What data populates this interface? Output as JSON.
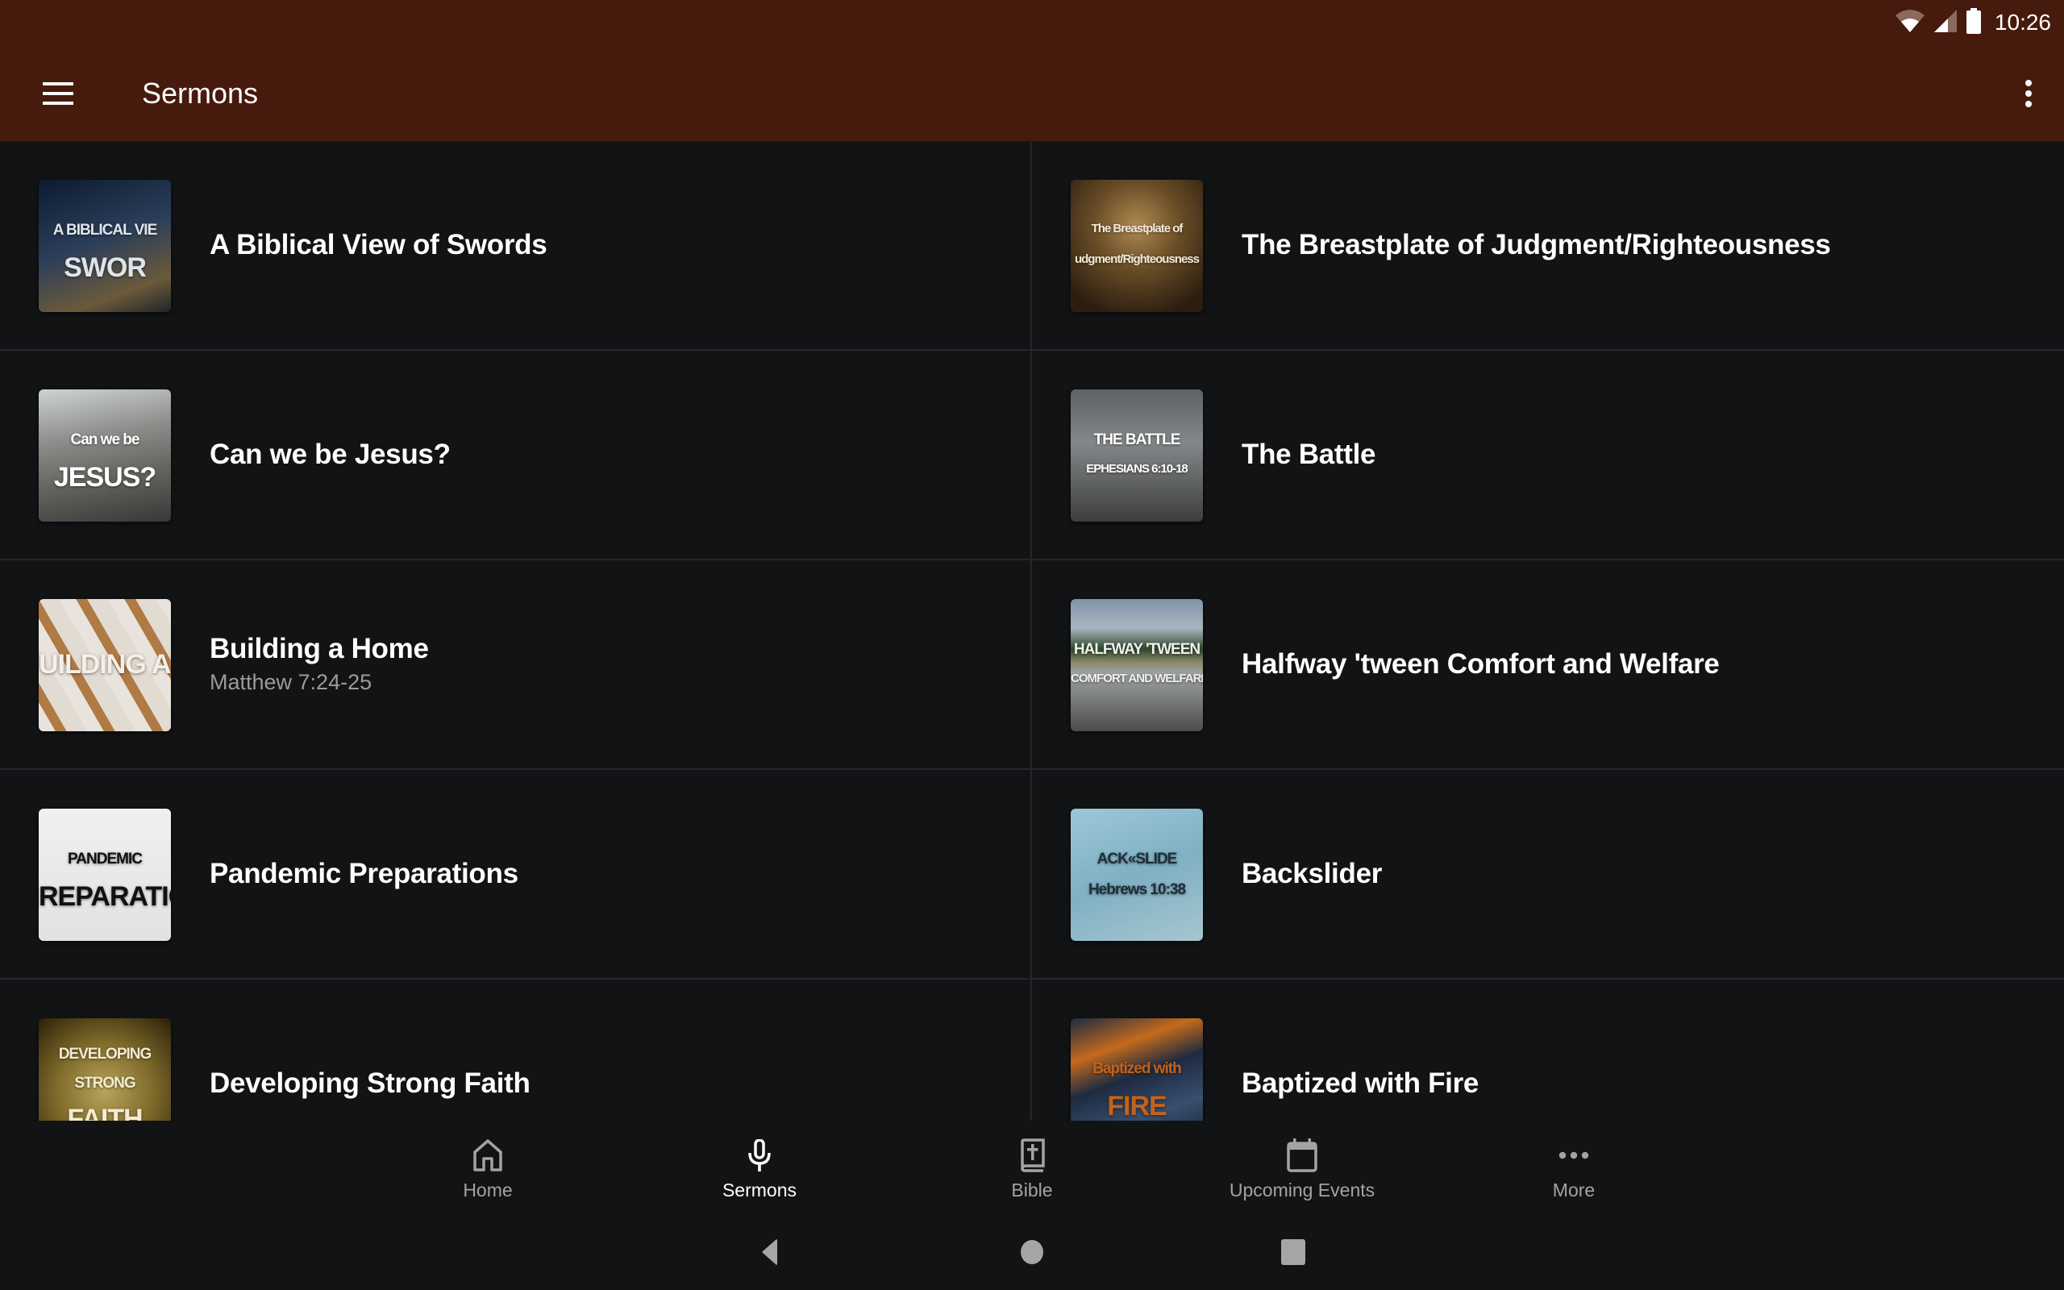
{
  "status_bar": {
    "time": "10:26",
    "icons": [
      "wifi-icon",
      "cell-signal-icon",
      "battery-icon"
    ]
  },
  "app_bar": {
    "title": "Sermons",
    "menu_icon": "hamburger-menu-icon",
    "overflow_icon": "more-vert-icon",
    "background": "#461a0c"
  },
  "sermons": [
    {
      "title": "A Biblical View of Swords",
      "subtitle": "",
      "thumb": {
        "lines": [
          "A BIBLICAL VIE",
          "SWOR"
        ],
        "bg": "linear-gradient(160deg,#0d1b2e 0%,#2a3d5a 45%,#6b5a3a 80%,#20242a 100%)",
        "fg": "#dfe4ea"
      }
    },
    {
      "title": "The Breastplate of Judgment/Righteousness",
      "subtitle": "",
      "thumb": {
        "lines": [
          "The Breastplate of",
          "udgment/Righteousness"
        ],
        "bg": "radial-gradient(circle at 50% 35%,#b08a52 0%,#6a4d27 40%,#2b1e10 85%)",
        "fg": "#f2ead8"
      }
    },
    {
      "title": "Can we be Jesus?",
      "subtitle": "",
      "thumb": {
        "lines": [
          "Can we be",
          "JESUS?"
        ],
        "bg": "linear-gradient(170deg,#cfd3d4 0%,#8d8f8c 35%,#6b6a66 60%,#3a3836 100%)",
        "fg": "#ffffff"
      }
    },
    {
      "title": "The Battle",
      "subtitle": "",
      "thumb": {
        "lines": [
          "THE BATTLE",
          "EPHESIANS 6:10-18"
        ],
        "bg": "linear-gradient(180deg,#5e6163 0%,#85888a 40%,#5a5c5d 75%,#3d3e3f 100%)",
        "fg": "#ffffff"
      }
    },
    {
      "title": "Building a Home",
      "subtitle": "Matthew 7:24-25",
      "thumb": {
        "lines": [
          "UILDING A HOM"
        ],
        "bg": "repeating-linear-gradient(60deg,#e8e3dc 0 18px,#b07a45 18px 30px,#e1dbd2 30px 52px)",
        "fg": "#f5efe6"
      }
    },
    {
      "title": "Halfway 'tween Comfort and Welfare",
      "subtitle": "",
      "thumb": {
        "lines": [
          "HALFWAY 'TWEEN",
          "COMFORT AND WELFARE"
        ],
        "bg": "linear-gradient(180deg,#7f95a8 0%,#a9b5bf 22%,#2f4a2a 38%,#8c8a6a 48%,#9fa2a3 56%,#4b4c4d 100%)",
        "fg": "#f0f0f0"
      }
    },
    {
      "title": "Pandemic Preparations",
      "subtitle": "",
      "thumb": {
        "lines": [
          "PANDEMIC",
          "REPARATION"
        ],
        "bg": "linear-gradient(180deg,#f0f0f0 0%,#e2e2e2 100%)",
        "fg": "#111111"
      }
    },
    {
      "title": "Backslider",
      "subtitle": "",
      "thumb": {
        "lines": [
          "ACK«SLIDE",
          "Hebrews 10:38"
        ],
        "bg": "linear-gradient(160deg,#9cc8d8 0%,#7fb0c4 50%,#a7c6cf 100%)",
        "fg": "#1f2f3a"
      }
    },
    {
      "title": "Developing Strong Faith",
      "subtitle": "",
      "thumb": {
        "lines": [
          "DEVELOPING",
          "STRONG",
          "FAITH"
        ],
        "bg": "radial-gradient(circle at 50% 55%,#b9a45a 0%,#7e6a2a 50%,#2a2008 100%)",
        "fg": "#f3ecd2"
      }
    },
    {
      "title": "Baptized with Fire",
      "subtitle": "",
      "thumb": {
        "lines": [
          "Baptized with",
          "FIRE"
        ],
        "bg": "linear-gradient(160deg,#1b2a44 0%,#c46a1c 25%,#1d2a40 45%,#394f6f 70%,#101a2a 100%)",
        "fg": "#c4621b"
      }
    }
  ],
  "bottom_nav": {
    "items": [
      {
        "label": "Home",
        "icon": "home-icon",
        "active": false
      },
      {
        "label": "Sermons",
        "icon": "microphone-icon",
        "active": true
      },
      {
        "label": "Bible",
        "icon": "bible-icon",
        "active": false
      },
      {
        "label": "Upcoming Events",
        "icon": "calendar-icon",
        "active": false
      },
      {
        "label": "More",
        "icon": "more-horiz-icon",
        "active": false
      }
    ]
  },
  "system_nav": {
    "buttons": [
      "back-icon",
      "home-circle-icon",
      "recents-icon"
    ]
  }
}
